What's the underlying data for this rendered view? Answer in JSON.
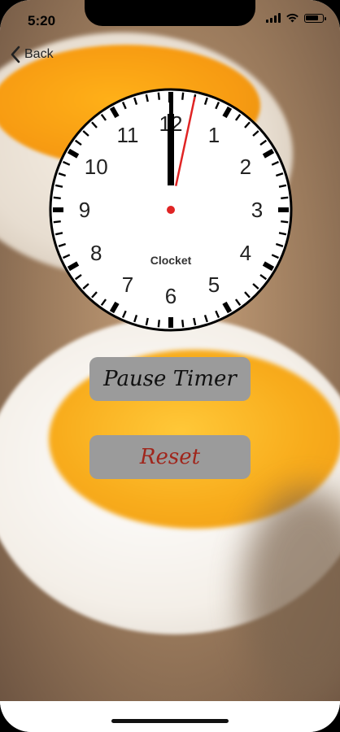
{
  "status_bar": {
    "time": "5:20",
    "battery_level": 0.85
  },
  "nav": {
    "back_label": "Back",
    "back_icon": "chevron-left-icon"
  },
  "clock": {
    "brand": "Clocket",
    "numbers": [
      "12",
      "1",
      "2",
      "3",
      "4",
      "5",
      "6",
      "7",
      "8",
      "9",
      "10",
      "11"
    ],
    "time": {
      "hour": 12,
      "minute": 0,
      "second": 2
    },
    "colors": {
      "face": "#ffffff",
      "rim": "#000000",
      "second_hand": "#e02424",
      "hands": "#000000"
    }
  },
  "buttons": {
    "pause_label": "Pause Timer",
    "reset_label": "Reset"
  },
  "colors": {
    "button_bg": "#9b9b9b",
    "reset_text": "#a0261c",
    "pause_text": "#111111"
  }
}
